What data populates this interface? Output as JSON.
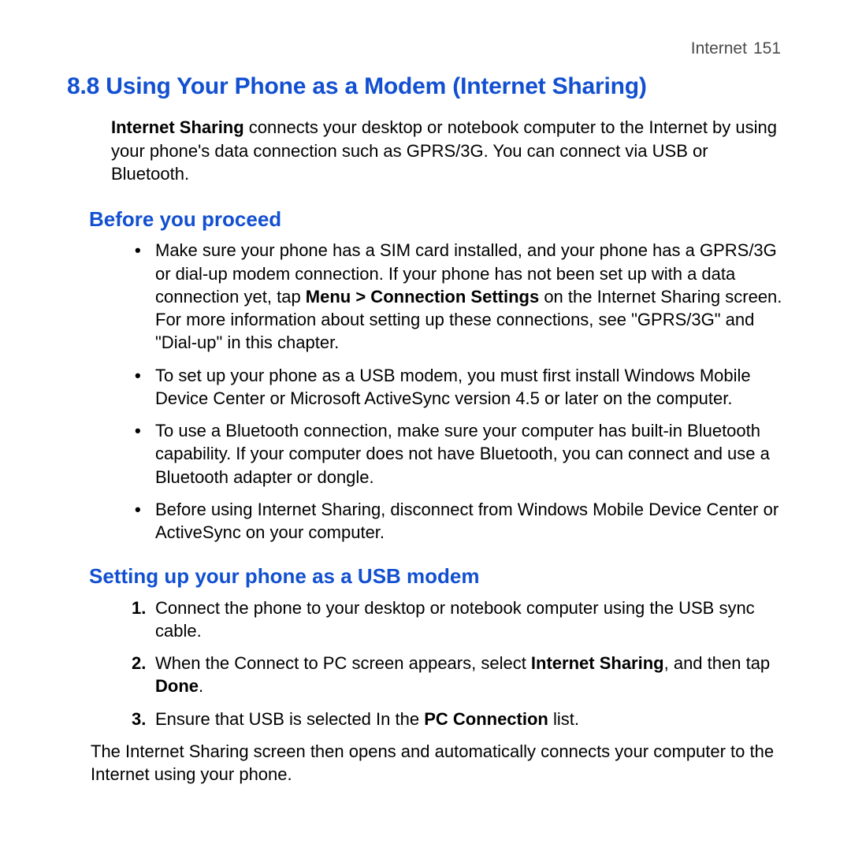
{
  "header": {
    "chapter": "Internet",
    "page": "151"
  },
  "title": "8.8  Using Your Phone as a Modem (Internet Sharing)",
  "intro": {
    "lead": "Internet Sharing",
    "rest": " connects your desktop or notebook computer to the Internet by using your phone's data connection such as GPRS/3G. You can connect via USB or Bluetooth."
  },
  "sub1": {
    "heading": "Before you proceed"
  },
  "bullets": {
    "b1_pre": "Make sure your phone has a SIM card installed, and your phone has a GPRS/3G or dial-up modem connection. If your phone has not been set up with a data connection yet, tap ",
    "b1_bold": "Menu > Connection Settings",
    "b1_post": " on the Internet Sharing screen. For more information about setting up these connections, see \"GPRS/3G\" and \"Dial-up\" in this chapter.",
    "b2": "To set up your phone as a USB modem, you must first install Windows Mobile Device Center or Microsoft ActiveSync version 4.5 or later on the computer.",
    "b3": "To use a Bluetooth connection, make sure your computer has built-in Bluetooth capability. If your computer does not have Bluetooth, you can connect and use a Bluetooth adapter or dongle.",
    "b4": "Before using Internet Sharing, disconnect from Windows Mobile Device Center or ActiveSync on your computer."
  },
  "sub2": {
    "heading": "Setting up your phone as a USB modem"
  },
  "steps": {
    "s1": "Connect the phone to your desktop or notebook computer using the USB sync cable.",
    "s2_pre": "When the Connect to PC screen appears, select ",
    "s2_bold1": "Internet Sharing",
    "s2_mid": ", and then tap ",
    "s2_bold2": "Done",
    "s2_post": ".",
    "s3_pre": "Ensure that USB is selected In the ",
    "s3_bold": "PC Connection",
    "s3_post": " list."
  },
  "closing": "The Internet Sharing screen then opens and automatically connects your computer to the Internet using your phone."
}
